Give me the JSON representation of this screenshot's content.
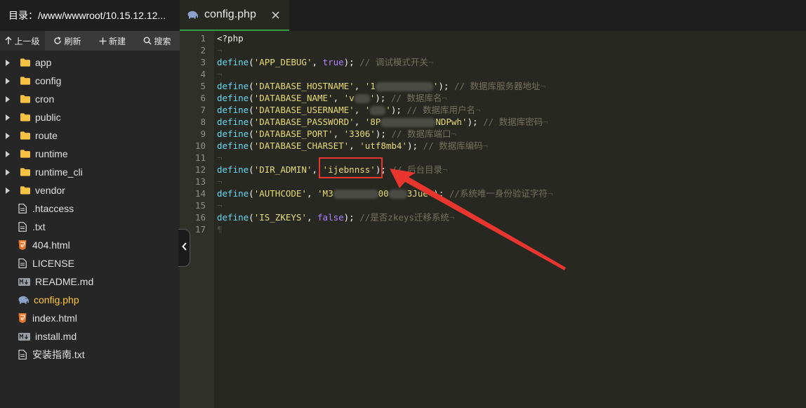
{
  "sidebar": {
    "header_title": "目录：/www/wwwroot/10.15.12.12...",
    "toolbar": {
      "up_label": "上一级",
      "refresh_label": "刷新",
      "new_label": "新建",
      "search_label": "搜索"
    },
    "items": [
      {
        "label": "app",
        "type": "folder"
      },
      {
        "label": "config",
        "type": "folder"
      },
      {
        "label": "cron",
        "type": "folder"
      },
      {
        "label": "public",
        "type": "folder"
      },
      {
        "label": "route",
        "type": "folder"
      },
      {
        "label": "runtime",
        "type": "folder"
      },
      {
        "label": "runtime_cli",
        "type": "folder"
      },
      {
        "label": "vendor",
        "type": "folder"
      },
      {
        "label": ".htaccess",
        "type": "file",
        "icon": "text-file-icon"
      },
      {
        "label": ".txt",
        "type": "file",
        "icon": "text-file-icon"
      },
      {
        "label": "404.html",
        "type": "file",
        "icon": "html5-icon"
      },
      {
        "label": "LICENSE",
        "type": "file",
        "icon": "text-file-icon"
      },
      {
        "label": "README.md",
        "type": "file",
        "icon": "markdown-icon"
      },
      {
        "label": "config.php",
        "type": "file",
        "icon": "php-elephant-icon",
        "active": true
      },
      {
        "label": "index.html",
        "type": "file",
        "icon": "html5-icon"
      },
      {
        "label": "install.md",
        "type": "file",
        "icon": "markdown-icon"
      },
      {
        "label": "安装指南.txt",
        "type": "file",
        "icon": "text-file-icon"
      }
    ]
  },
  "tabs": [
    {
      "label": "config.php",
      "active": true,
      "icon": "php-elephant-icon"
    }
  ],
  "editor": {
    "line_numbers": [
      "1",
      "2",
      "3",
      "4",
      "5",
      "6",
      "7",
      "8",
      "9",
      "10",
      "11",
      "12",
      "13",
      "14",
      "15",
      "16",
      "17"
    ],
    "lines": {
      "l1": "<?php",
      "eol": "¬",
      "pilcrow": "¶",
      "define": "define",
      "paren_open": "(",
      "paren_close": ");",
      "comma": ", ",
      "l3_key": "'APP_DEBUG'",
      "l3_val": "true",
      "l3_comment": " // 调试模式开关",
      "l5_key": "'DATABASE_HOSTNAME'",
      "l5_val_visible": "'1",
      "l5_val_end": "'",
      "l5_comment": " // 数据库服务器地址",
      "l6_key": "'DATABASE_NAME'",
      "l6_val_visible": "'v",
      "l6_val_end": "'",
      "l6_comment": " // 数据库名",
      "l7_key": "'DATABASE_USERNAME'",
      "l7_val_visible": "'",
      "l7_val_end": "'",
      "l7_comment": " // 数据库用户名",
      "l8_key": "'DATABASE_PASSWORD'",
      "l8_val_start": "'8P",
      "l8_val_end": "NDPwh'",
      "l8_comment": " // 数据库密码",
      "l9_key": "'DATABASE_PORT'",
      "l9_val": "'3306'",
      "l9_comment": " // 数据库端口",
      "l10_key": "'DATABASE_CHARSET'",
      "l10_val": "'utf8mb4'",
      "l10_comment": " // 数据库编码",
      "l12_key": "'DIR_ADMIN'",
      "l12_val": "'ijebnnss'",
      "l12_comment": " // 后台目录",
      "l14_key": "'AUTHCODE'",
      "l14_val_start": "'M3",
      "l14_val_mid": "00",
      "l14_val_end": "3Jue'",
      "l14_comment": " //系统唯一身份验证字符",
      "l16_key": "'IS_ZKEYS'",
      "l16_val": "false",
      "l16_comment": " //是否zkeys迁移系统"
    }
  },
  "annotation": {
    "color": "#e8362f"
  },
  "colors": {
    "keyword": "#66d9ef",
    "string": "#e6db74",
    "boolean": "#ae81ff",
    "comment": "#75715e",
    "active_file": "#ffc733",
    "tab_underline": "#2ea043"
  }
}
